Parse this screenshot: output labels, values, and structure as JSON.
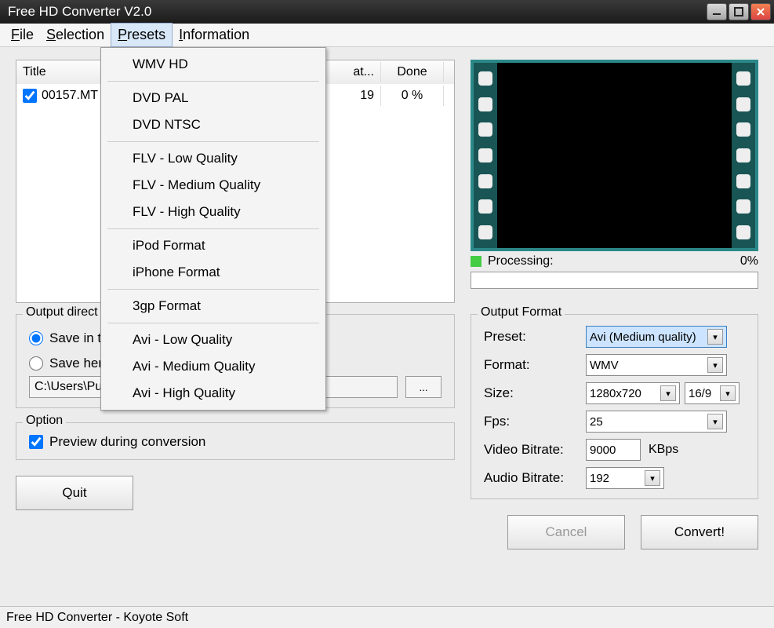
{
  "window": {
    "title": "Free HD Converter V2.0"
  },
  "menubar": {
    "file": "File",
    "selection": "Selection",
    "presets": "Presets",
    "information": "Information"
  },
  "presets_menu": {
    "items": [
      "WMV HD",
      "DVD PAL",
      "DVD NTSC",
      "FLV - Low Quality",
      "FLV - Medium Quality",
      "FLV - High Quality",
      "iPod Format",
      "iPhone Format",
      "3gp Format",
      "Avi - Low Quality",
      "Avi - Medium Quality",
      "Avi - High Quality"
    ]
  },
  "filelist": {
    "headers": {
      "title": "Title",
      "duration_partial": "at...",
      "done": "Done"
    },
    "rows": [
      {
        "title": "00157.MT",
        "duration_partial": "19",
        "done": "0 %"
      }
    ]
  },
  "preview": {
    "status_label": "Processing:",
    "progress_pct": "0%"
  },
  "output_dir": {
    "legend": "Output direct",
    "radio1_partial": "Save in t",
    "radio2_partial": "Save here",
    "path": "C:\\Users\\Public\\Videos",
    "browse": "..."
  },
  "option": {
    "legend": "Option",
    "preview_label": "Preview during conversion"
  },
  "output_format": {
    "legend": "Output Format",
    "labels": {
      "preset": "Preset:",
      "format": "Format:",
      "size": "Size:",
      "fps": "Fps:",
      "vbitrate": "Video Bitrate:",
      "abitrate": "Audio Bitrate:"
    },
    "values": {
      "preset": "Avi (Medium quality)",
      "format": "WMV",
      "size": "1280x720",
      "aspect": "16/9",
      "fps": "25",
      "vbitrate": "9000",
      "vbitrate_unit": "KBps",
      "abitrate": "192"
    }
  },
  "buttons": {
    "quit": "Quit",
    "cancel": "Cancel",
    "convert": "Convert!"
  },
  "statusbar": "Free HD Converter - Koyote Soft"
}
